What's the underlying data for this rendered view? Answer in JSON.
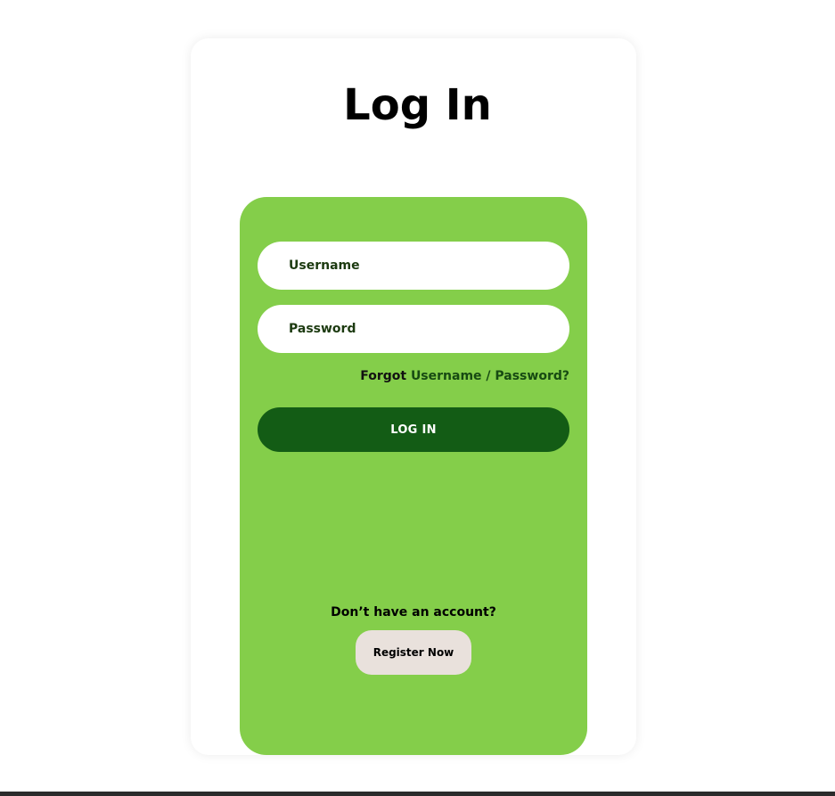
{
  "title": "Log In",
  "form": {
    "username_placeholder": "Username",
    "password_placeholder": "Password",
    "forgot_prefix": "Forgot",
    "forgot_link": "Username / Password?",
    "login_label": "LOG IN"
  },
  "register": {
    "prompt": "Don’t have an account?",
    "button_label": "Register Now"
  },
  "colors": {
    "panel": "#84ce4a",
    "login_button": "#135c15",
    "register_button": "#e9e1dc"
  }
}
